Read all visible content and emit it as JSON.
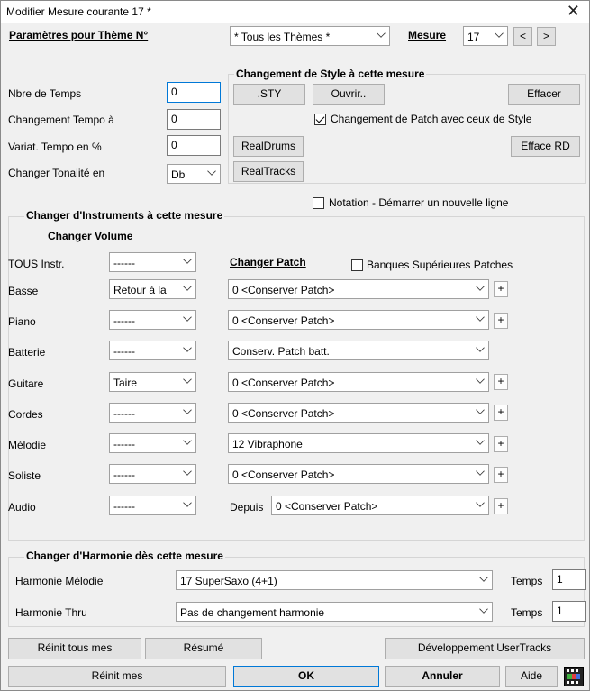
{
  "window": {
    "title": "Modifier Mesure courante 17 *"
  },
  "theme": {
    "label": "Paramètres pour Thème N°",
    "select": "* Tous les Thèmes *"
  },
  "measure": {
    "label": "Mesure",
    "value": "17",
    "prev": "<",
    "next": ">"
  },
  "left_fields": [
    {
      "label": "Nbre de Temps",
      "value": "0"
    },
    {
      "label": "Changement Tempo à",
      "value": "0"
    },
    {
      "label": "Variat. Tempo en %",
      "value": "0"
    },
    {
      "label": "Changer Tonalité en",
      "value": "Db"
    }
  ],
  "style_group": {
    "title": "Changement de Style à cette mesure",
    "sty_btn": ".STY",
    "open_btn": "Ouvrir..",
    "clear_btn": "Effacer",
    "patch_check_label": "Changement de Patch avec ceux de Style",
    "patch_checked": true,
    "realdrums_btn": "RealDrums",
    "clear_rd_btn": "Efface RD",
    "realtracks_btn": "RealTracks"
  },
  "notation": {
    "label": "Notation - Démarrer un nouvelle ligne",
    "checked": false
  },
  "instruments": {
    "title": "Changer d'Instruments à cette mesure",
    "volume_header": "Changer Volume",
    "patch_header": "Changer Patch",
    "banks_label": "Banques Supérieures Patches",
    "plus": "+",
    "depuis": "Depuis",
    "rows": [
      {
        "name": "TOUS Instr.",
        "volume": "------"
      },
      {
        "name": "Basse",
        "volume": "Retour à la",
        "patch": "0 <Conserver Patch>"
      },
      {
        "name": "Piano",
        "volume": "------",
        "patch": "0 <Conserver Patch>"
      },
      {
        "name": "Batterie",
        "volume": "------",
        "patch": "Conserv. Patch batt."
      },
      {
        "name": "Guitare",
        "volume": "Taire",
        "patch": "0 <Conserver Patch>"
      },
      {
        "name": "Cordes",
        "volume": "------",
        "patch": "0 <Conserver Patch>"
      },
      {
        "name": "Mélodie",
        "volume": "------",
        "patch": "12 Vibraphone"
      },
      {
        "name": "Soliste",
        "volume": "------",
        "patch": "0 <Conserver Patch>"
      },
      {
        "name": "Audio",
        "volume": "------",
        "patch": "0 <Conserver Patch>"
      }
    ]
  },
  "harmony": {
    "title": "Changer d'Harmonie dès cette mesure",
    "rows": [
      {
        "label": "Harmonie Mélodie",
        "value": "17 SuperSaxo (4+1)",
        "temps_label": "Temps",
        "temps": "1"
      },
      {
        "label": "Harmonie Thru",
        "value": "Pas de changement harmonie",
        "temps_label": "Temps",
        "temps": "1"
      }
    ]
  },
  "buttons": {
    "reset_all": "Réinit tous mes",
    "summary": "Résumé",
    "usertracks": "Développement UserTracks",
    "reset": "Réinit mes",
    "ok": "OK",
    "cancel": "Annuler",
    "help": "Aide"
  }
}
